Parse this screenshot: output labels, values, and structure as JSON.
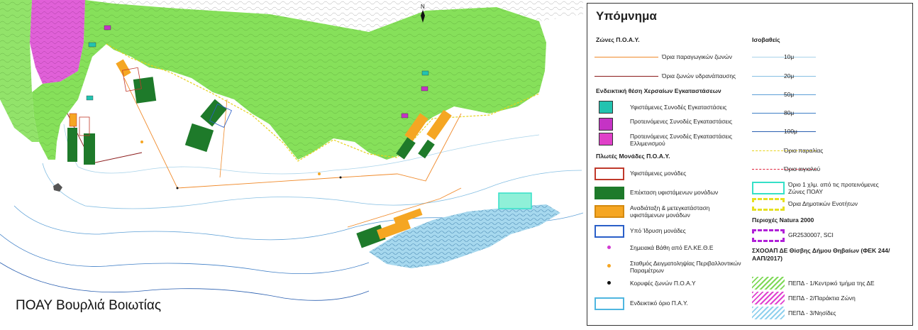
{
  "caption": "ΠΟΑΥ Βουρλιά Βοιωτίας",
  "legend": {
    "title": "Υπόμνημα",
    "left_column": [
      {
        "kind": "header",
        "label": "Ζώνες Π.Ο.Α.Υ."
      },
      {
        "kind": "line",
        "color": "#f08a2a",
        "label": "Όρια παραγωγικών ζωνών"
      },
      {
        "kind": "line",
        "color": "#8b1a1a",
        "label": "Όρια ζωνών υδρανάπαυσης"
      },
      {
        "kind": "header",
        "label": "Ενδεικτική θέση Χερσαίων Εγκαταστάσεων"
      },
      {
        "kind": "icon",
        "color": "#22c3b0",
        "label": "Υφιστάμενες  Συνοδές Εγκαταστάσεις"
      },
      {
        "kind": "icon",
        "color": "#c533c5",
        "label": "Προτεινόμενες Συνοδές  Εγκαταστάσεις"
      },
      {
        "kind": "icon",
        "color": "#e040c8",
        "label": "Προτεινόμενες Συνοδές  Εγκαταστάσεις Ελλιμενισμού"
      },
      {
        "kind": "header",
        "label": "Πλωτές Μονάδες Π.Ο.Α.Υ."
      },
      {
        "kind": "box",
        "fill": "#ffffff",
        "stroke": "#c0392b",
        "label": "Υφιστάμενες μονάδες"
      },
      {
        "kind": "box",
        "fill": "#1e7a2a",
        "stroke": "#1e7a2a",
        "label": "Επέκταση υφιστάμενων μονάδων"
      },
      {
        "kind": "box",
        "fill": "#f5a623",
        "stroke": "#d48a10",
        "label": "Αναδιάταξη & μετεγκατάσταση υφιστάμενων μονάδων"
      },
      {
        "kind": "box",
        "fill": "#ffffff",
        "stroke": "#2a5fc8",
        "label": "Υπό Ίδρυση μονάδες"
      },
      {
        "kind": "dot",
        "color": "#d23ad2",
        "label": "Σημειακά Βάθη από ΕΛ.ΚΕ.Θ.Ε"
      },
      {
        "kind": "dot",
        "color": "#f5a623",
        "label": "Σταθμός Δειγματοληψίας Περιβαλλοντικών Παραμέτρων"
      },
      {
        "kind": "dot",
        "color": "#111111",
        "label": "Κορυφές ζωνών Π.Ο.Α.Υ"
      },
      {
        "kind": "box",
        "fill": "#ffffff",
        "stroke": "#4fb6e0",
        "label": "Ενδεικτικό όριο Π.Α.Υ."
      }
    ],
    "right_column": [
      {
        "kind": "header",
        "label": "Ισοβαθείς"
      },
      {
        "kind": "line",
        "color": "#a9d3ea",
        "label": "10μ"
      },
      {
        "kind": "line",
        "color": "#86bfe3",
        "label": "20μ"
      },
      {
        "kind": "line",
        "color": "#5c9fd6",
        "label": "50μ"
      },
      {
        "kind": "line",
        "color": "#3e7ec6",
        "label": "80μ"
      },
      {
        "kind": "line",
        "color": "#2a5fb0",
        "label": "100μ"
      },
      {
        "kind": "dashline",
        "color": "#e6d21a",
        "label": "Όρια παραλίας"
      },
      {
        "kind": "dashline",
        "color": "#e0203a",
        "label": "Όρια αιγιαλού"
      },
      {
        "kind": "box",
        "fill": "#ffffff",
        "stroke": "#35e0c8",
        "label": "Όριο 1 χλμ. από τις προτεινόμενες Ζώνες ΠΟΑΥ"
      },
      {
        "kind": "dashbox",
        "fill": "#ffffff",
        "stroke": "#e6e020",
        "label": "Όρια Δημοτικών Ενοτήτων"
      },
      {
        "kind": "header",
        "label": "Περιοχές Natura 2000"
      },
      {
        "kind": "dashbox",
        "fill": "#ffffff",
        "stroke": "#b020d8",
        "label": "GR2530007, SCI"
      },
      {
        "kind": "header",
        "label": "ΣΧΟΟΑΠ ΔΕ Θίσβης Δήμου Θηβαίων (ΦΕΚ 244/ΑΑΠ/2017)"
      },
      {
        "kind": "hatch",
        "color": "#7ed957",
        "label": "ΠΕΠΔ - 1/Κεντρικό τμήμα της ΔΕ"
      },
      {
        "kind": "hatch",
        "color": "#e040d0",
        "label": "ΠΕΠΔ - 2/Παράκτια Ζώνη"
      },
      {
        "kind": "hatch",
        "color": "#8fd0ee",
        "label": "ΠΕΠΔ - 3/Νησίδες"
      }
    ]
  },
  "map": {
    "north_label": "N",
    "colors": {
      "land_zone": "#86e05a",
      "coastal_zone": "#e060d8",
      "islands": "#a6d8ee",
      "expansion": "#1e7a2a",
      "relocation": "#f5a623",
      "buffer": "#8ff0d8"
    }
  }
}
